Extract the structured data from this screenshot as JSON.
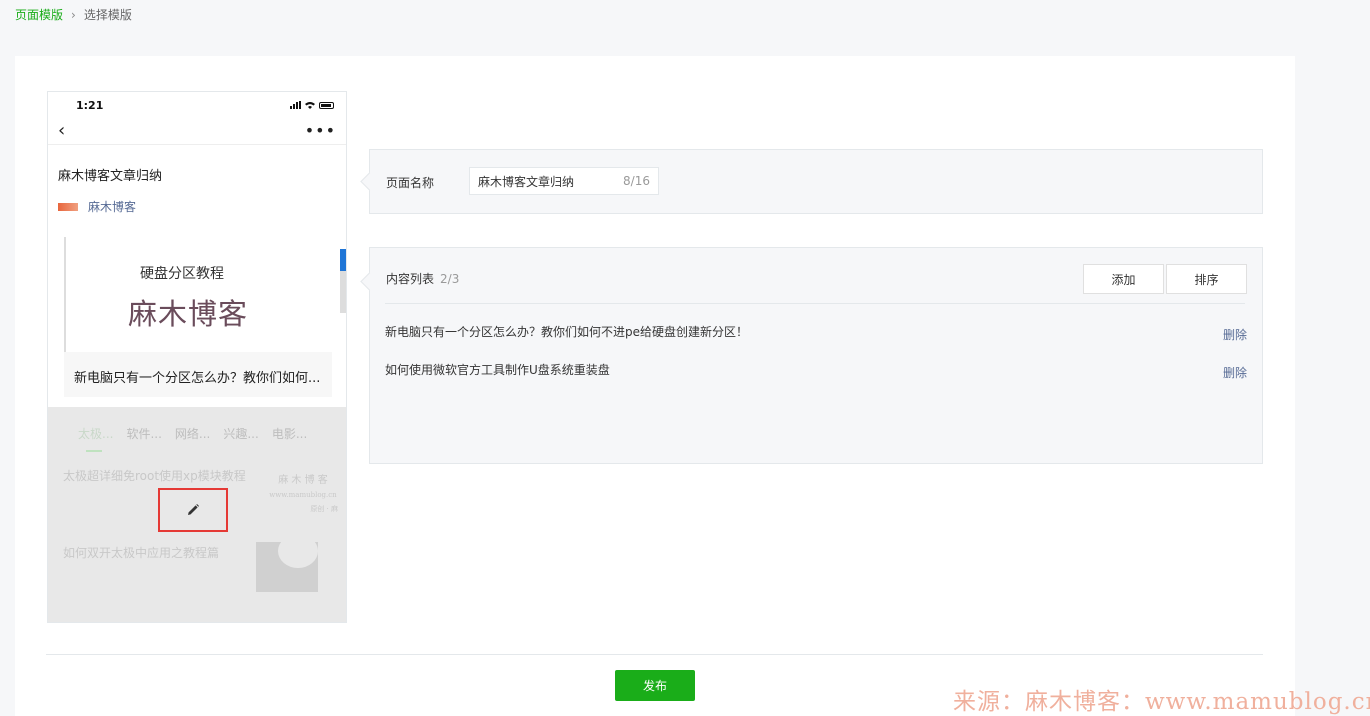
{
  "breadcrumb": {
    "parent": "页面模版",
    "separator": "›",
    "current": "选择模版"
  },
  "phone": {
    "time": "1:21",
    "nav_back": "‹",
    "nav_more": "•••",
    "article_title": "麻木博客文章归纳",
    "author": "麻木博客",
    "cover_sub": "硬盘分区教程",
    "cover_big": "麻木博客",
    "cover_caption": "新电脑只有一个分区怎么办？教你们如何...",
    "tabs": [
      "太极...",
      "软件...",
      "网络...",
      "兴趣...",
      "电影..."
    ],
    "list_item_1": "太极超详细免root使用xp模块教程",
    "list_item_2": "如何双开太极中应用之教程篇",
    "watermark_line1": "麻 木 博 客",
    "watermark_line2": "www.mamublog.cn",
    "watermark_line3": "原创 · 麻"
  },
  "page_name": {
    "label": "页面名称",
    "value": "麻木博客文章归纳",
    "counter": "8/16"
  },
  "content_list": {
    "label": "内容列表",
    "count": "2/3",
    "add_label": "添加",
    "sort_label": "排序",
    "items": [
      {
        "title": "新电脑只有一个分区怎么办？教你们如何不进pe给硬盘创建新分区！",
        "action": "删除"
      },
      {
        "title": "如何使用微软官方工具制作U盘系统重装盘",
        "action": "删除"
      }
    ]
  },
  "publish_label": "发布",
  "source_watermark": "来源：麻木博客：www.mamublog.cn"
}
